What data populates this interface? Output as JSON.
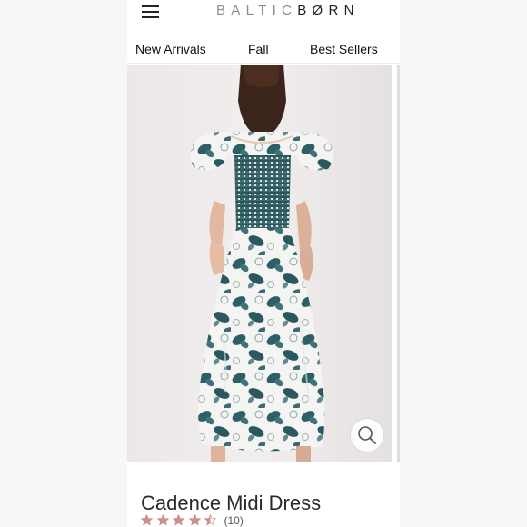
{
  "header": {
    "brand_light": "BALTIC",
    "brand_dark": "BØRN",
    "menu_icon": "hamburger-menu-icon"
  },
  "nav": {
    "items": [
      "New Arrivals",
      "Fall",
      "Best Sellers"
    ]
  },
  "gallery": {
    "zoom_icon": "magnifier-icon"
  },
  "product": {
    "title": "Cadence Midi Dress",
    "rating": 4.5,
    "rating_max": 5,
    "review_count": "(10)"
  },
  "colors": {
    "star": "#c8928d",
    "text": "#2a2a2a",
    "dress_print": "#2f5f66",
    "background": "#efeceb"
  }
}
